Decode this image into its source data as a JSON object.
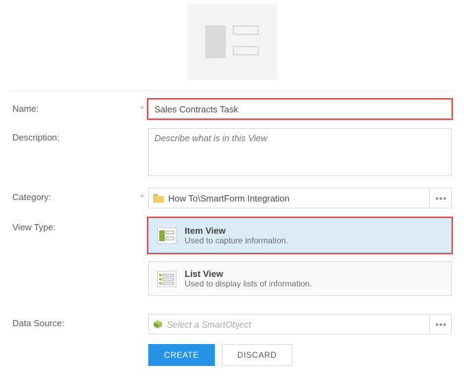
{
  "labels": {
    "name": "Name:",
    "description": "Description:",
    "category": "Category:",
    "view_type": "View Type:",
    "data_source": "Data Source:"
  },
  "fields": {
    "name_value": "Sales Contracts Task",
    "description_placeholder": "Describe what is in this View",
    "category_value": "How To\\SmartForm Integration",
    "data_source_placeholder": "Select a SmartObject"
  },
  "view_types": {
    "item": {
      "title": "Item View",
      "subtitle": "Used to capture information."
    },
    "list": {
      "title": "List View",
      "subtitle": "Used to display lists of information."
    }
  },
  "buttons": {
    "create": "CREATE",
    "discard": "DISCARD"
  }
}
